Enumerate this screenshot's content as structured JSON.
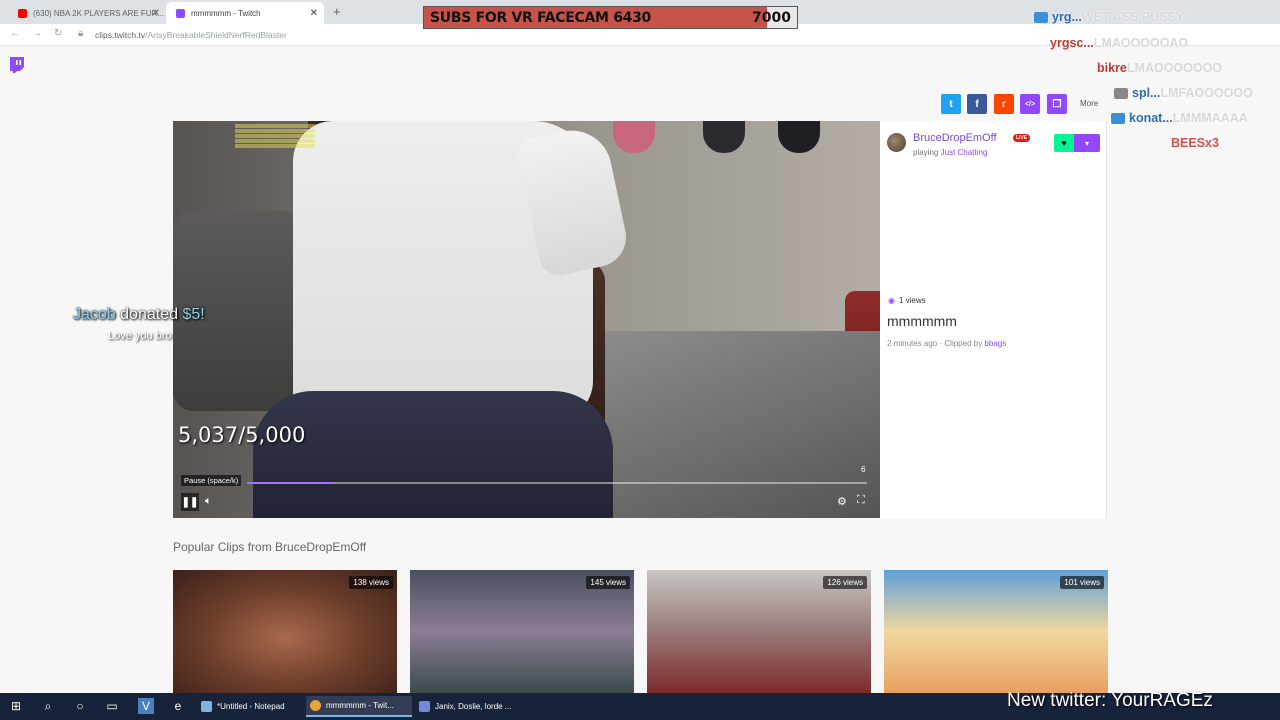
{
  "browser": {
    "tabs": [
      {
        "label": "(630) NBA 2K PLAYERS ARE FUR...",
        "favicon_color": "#ff0000"
      },
      {
        "label": "mmmmmm - Twitch",
        "favicon_color": "#9147ff"
      }
    ],
    "url_host": "clips.twitch.tv",
    "url_path": "/ArtsyBreakableShieldNerfRedBlaster"
  },
  "overlay": {
    "subs_label": "SUBS FOR VR FACECAM 6430",
    "subs_goal": "7000",
    "subs_current": 6430,
    "subs_target": 7000,
    "donation_name": "Jacob",
    "donation_word": "donated",
    "donation_amount": "$5!",
    "donation_message": "Love you bro",
    "new_twitter": "New twitter: YourRAGEz",
    "chat": [
      {
        "user": "yrg...",
        "msg": "WET ASS PUSSY",
        "color": "#2b6cb0"
      },
      {
        "user": "yrgsc...",
        "msg": "LMAOOOOOAO",
        "color": "#c0392b"
      },
      {
        "user": "bikre",
        "msg": "LMAOOOOOOO",
        "color": "#c0392b"
      },
      {
        "user": "spl...",
        "msg": "LMFAOOOOOO",
        "color": "#2b6cb0"
      },
      {
        "user": "konat...",
        "msg": "LMMMAAAA",
        "color": "#2b6cb0"
      },
      {
        "user": "BEESx3",
        "msg": "",
        "color": "#d94f4f"
      }
    ]
  },
  "share": {
    "more_label": "More",
    "buttons": [
      {
        "name": "twitter",
        "color": "#1da1f2",
        "glyph": "t"
      },
      {
        "name": "facebook",
        "color": "#3b5998",
        "glyph": "f"
      },
      {
        "name": "reddit",
        "color": "#ff4500",
        "glyph": "r"
      },
      {
        "name": "embed",
        "color": "#9147ff",
        "glyph": "</>"
      },
      {
        "name": "copy",
        "color": "#9147ff",
        "glyph": "❐"
      }
    ]
  },
  "player": {
    "count": "5,037/5,000",
    "pause_tooltip": "Pause (space/k)",
    "timer": "6",
    "progress": 0.14
  },
  "clip": {
    "streamer": "BruceDropEmOff",
    "live_badge": "LIVE",
    "playing_prefix": "playing",
    "game": "Just Chatting",
    "views": "1 views",
    "title": "mmmmmm",
    "time_ago": "2 minutes ago",
    "clipped_by_prefix": "· Clipped by",
    "clipped_by": "bbags"
  },
  "popular": {
    "heading": "Popular Clips from BruceDropEmOff",
    "clips": [
      {
        "views": "138 views"
      },
      {
        "views": "145 views"
      },
      {
        "views": "126 views"
      },
      {
        "views": "101 views"
      }
    ]
  },
  "taskbar": {
    "items": [
      {
        "label": "*Untitled - Notepad"
      },
      {
        "label": "mmmmmm - Twit..."
      },
      {
        "label": "Janix, Doslie, lorde ..."
      }
    ]
  }
}
